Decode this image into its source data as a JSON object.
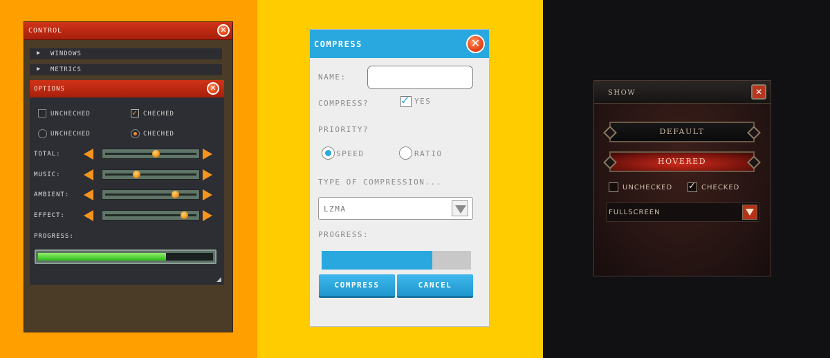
{
  "colors": {
    "orange_bg": "#ff9f00",
    "yellow_bg": "#ffcc00",
    "dark_bg": "#111013",
    "accent_red": "#c2290f",
    "accent_blue": "#29a8e0",
    "accent_orange": "#f7941d",
    "progress_green": "#4ed23a"
  },
  "icons": {
    "close": "close-icon",
    "expand": "triangle-right-icon",
    "arrow_left": "arrow-left-icon",
    "arrow_right": "arrow-right-icon",
    "dropdown": "triangle-down-icon",
    "resize": "resize-grip-icon"
  },
  "panel1": {
    "title": "CONTROL",
    "close_glyph": "✕",
    "sections": [
      {
        "label": "WINDOWS",
        "glyph": "▶"
      },
      {
        "label": "METRICS",
        "glyph": "▶"
      }
    ],
    "options": {
      "title": "OPTIONS",
      "close_glyph": "✕",
      "checkboxes": [
        {
          "label": "UNCHECHED",
          "checked": false
        },
        {
          "label": "CHECHED",
          "checked": true
        }
      ],
      "radios": [
        {
          "label": "UNCHECHED",
          "checked": false
        },
        {
          "label": "CHECHED",
          "checked": true
        }
      ],
      "sliders": [
        {
          "label": "TOTAL:",
          "value": 0.55
        },
        {
          "label": "MUSIC:",
          "value": 0.35
        },
        {
          "label": "AMBIENT:",
          "value": 0.75
        },
        {
          "label": "EFFECT:",
          "value": 0.84
        }
      ],
      "progress_label": "PROGRESS:",
      "progress_value": 0.73
    }
  },
  "panel2": {
    "title": "COMPRESS",
    "close_glyph": "✕",
    "name_label": "NAME:",
    "name_value": "",
    "compress_label": "COMPRESS?",
    "compress_checkbox": {
      "label": "YES",
      "checked": true
    },
    "priority_label": "PRIORITY?",
    "priority_options": [
      {
        "label": "SPEED",
        "checked": true
      },
      {
        "label": "RATIO",
        "checked": false
      }
    ],
    "type_label": "TYPE OF COMPRESSION...",
    "type_value": "LZMA",
    "progress_label": "PROGRESS:",
    "progress_value": 0.74,
    "buttons": {
      "compress": "COMPRESS",
      "cancel": "CANCEL"
    }
  },
  "panel3": {
    "title": "SHOW",
    "close_glyph": "✕",
    "buttons": {
      "default": "DEFAULT",
      "hovered": "HOVERED"
    },
    "checkboxes": [
      {
        "label": "UNCHECKED",
        "checked": false
      },
      {
        "label": "CHECKED",
        "checked": true
      }
    ],
    "select_value": "FULLSCREEN"
  }
}
